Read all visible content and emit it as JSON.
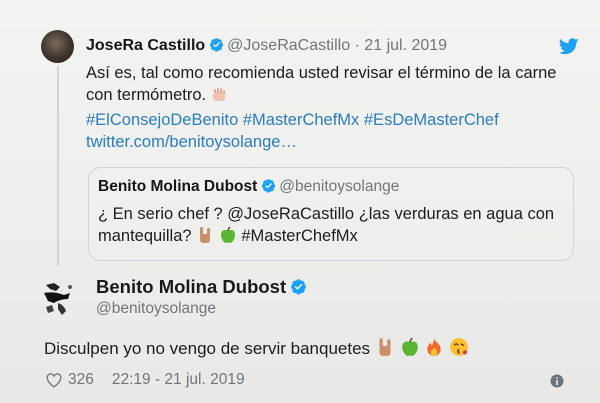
{
  "tweet": {
    "author_name": "JoseRa Castillo",
    "author_handle": "@JoseRaCastillo",
    "separator": "·",
    "date": "21 jul. 2019",
    "text_line1": "Así es, tal como recomienda usted revisar el término de la carne",
    "text_line2": "con termómetro.",
    "hashtags": "#ElConsejoDeBenito #MasterChefMx #EsDeMasterChef",
    "link": "twitter.com/benitoysolange…"
  },
  "quoted": {
    "author_name": "Benito Molina Dubost",
    "author_handle": "@benitoysolange",
    "text_part1": "¿ En serio chef ? @JoseRaCastillo ¿las verduras en agua con",
    "text_part2": "mantequilla?",
    "hashtag": "#MasterChefMx"
  },
  "reply": {
    "author_name": "Benito Molina Dubost",
    "author_handle": "@benitoysolange",
    "text": "Disculpen yo no vengo de servir banquetes",
    "likes": "326",
    "time": "22:19 - 21 jul. 2019"
  },
  "icons": {
    "bird": "twitter-bird-icon",
    "verified": "verified-badge-icon",
    "like": "heart-icon",
    "info": "info-icon"
  },
  "colors": {
    "link": "#2b7dbd",
    "verified": "#1da1f2",
    "muted": "#6e767d"
  }
}
